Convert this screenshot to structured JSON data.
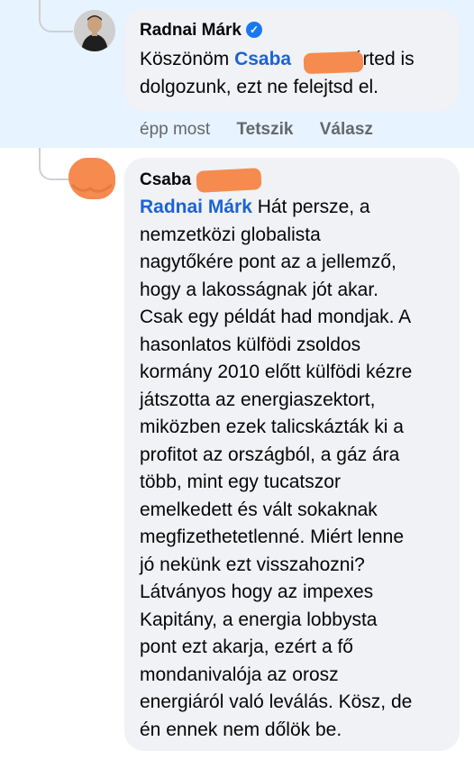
{
  "reply": {
    "author": "Radnai Márk",
    "verified": true,
    "mention": "Csaba",
    "text_before": "Köszönöm ",
    "text_after": ", érted is\ndolgozunk, ezt ne felejtsd el.",
    "time": "épp most",
    "like_label": "Tetszik",
    "reply_label": "Válasz"
  },
  "comment": {
    "author": "Csaba",
    "mention": "Radnai Márk",
    "text": " Hát persze, a\nnemzetközi globalista\nnagytőkére pont az a jellemző,\nhogy a lakosságnak jót akar.\nCsak egy példát had mondjak. A\nhasonlatos külfödi zsoldos\nkormány 2010 előtt külfödi kézre\njátszotta az energiaszektort,\nmiközben ezek talicskázták ki a\nprofitot az országból, a gáz ára\ntöbb, mint egy tucatszor\nemelkedett és vált sokaknak\nmegfizethetetlenné. Miért lenne\njó nekünk ezt visszahozni?\nLátványos hogy az impexes\nKapitány, a energia lobbysta\npont ezt akarja, ezért a fő\nmondanivalója az orosz\nenergiáról való leválás. Kösz, de\nén ennek nem dőlök be."
  },
  "colors": {
    "highlight": "#e7f3ff",
    "bubble": "#f0f2f5",
    "mention": "#1b63d3",
    "redaction": "#f58b4f",
    "verified": "#1877f2"
  }
}
